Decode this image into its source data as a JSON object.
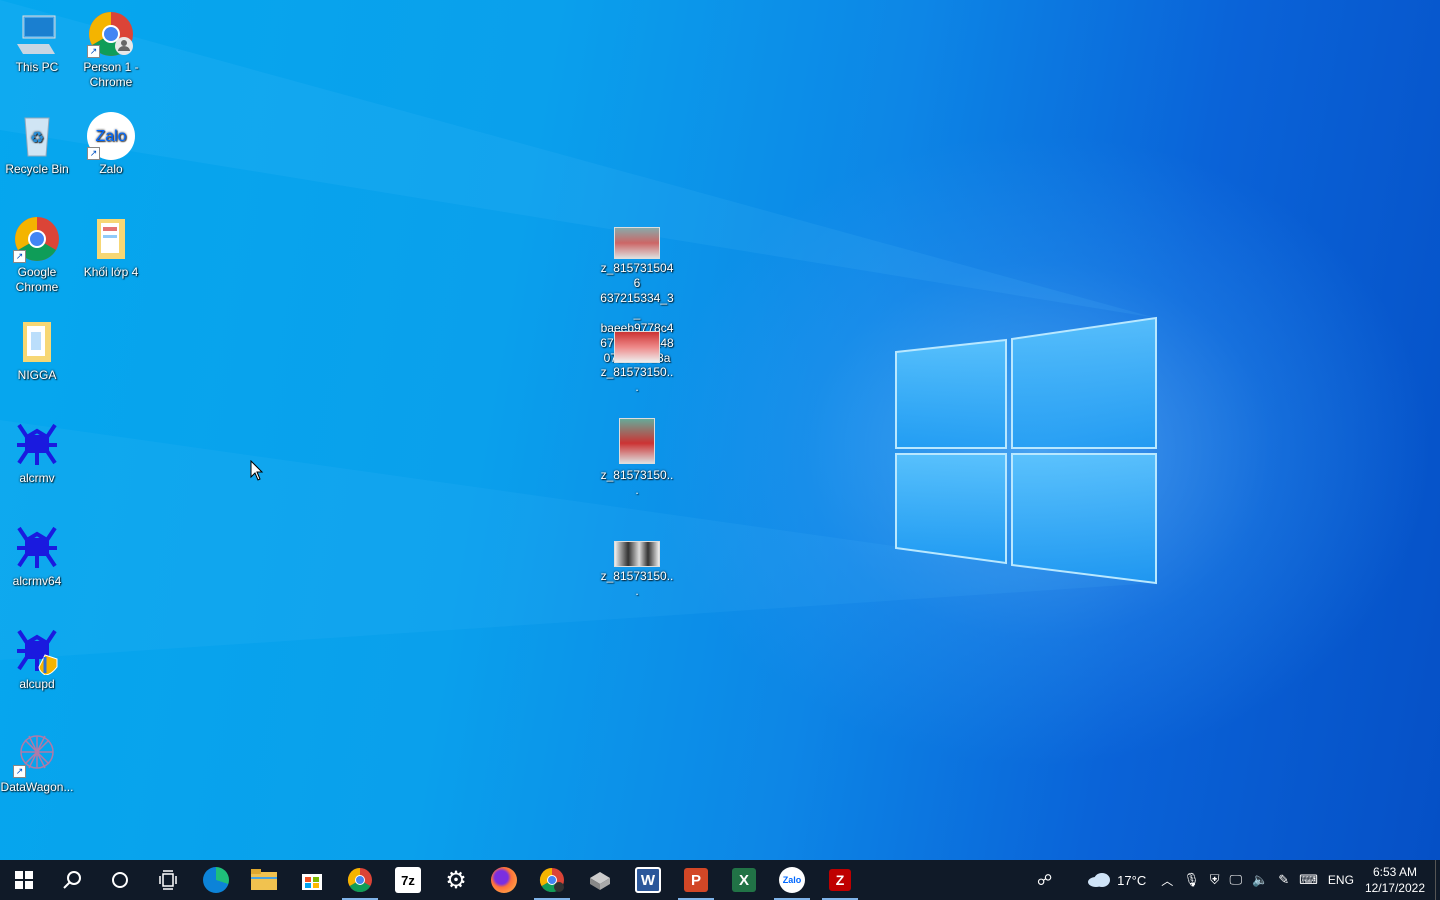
{
  "desktop": {
    "icons": [
      {
        "label": "This PC",
        "icon": "this-pc-icon"
      },
      {
        "label": "Person 1 - Chrome",
        "icon": "chrome-profile-icon"
      },
      {
        "label": "Recycle Bin",
        "icon": "recycle-bin-icon"
      },
      {
        "label": "Zalo",
        "icon": "zalo-icon"
      },
      {
        "label": "Google Chrome",
        "icon": "chrome-icon"
      },
      {
        "label": "Khối lớp 4",
        "icon": "folder-icon"
      },
      {
        "label": "NIGGA",
        "icon": "folder-icon"
      },
      {
        "label": "alcrmv",
        "icon": "realtek-icon"
      },
      {
        "label": "alcrmv64",
        "icon": "realtek-icon"
      },
      {
        "label": "alcupd",
        "icon": "realtek-shield-icon"
      },
      {
        "label": "DataWagon...",
        "icon": "datawagon-icon"
      }
    ],
    "files": [
      {
        "label": "z_8157315046\n637215334_3_\nbaeeb9778c4\n67d46578a48\n072e4d728a"
      },
      {
        "label": "z_81573150..."
      },
      {
        "label": "z_81573150..."
      },
      {
        "label": "z_81573150..."
      }
    ]
  },
  "taskbar": {
    "apps": [
      {
        "name": "start-button",
        "icon": "windows-icon"
      },
      {
        "name": "search-button",
        "icon": "search-icon"
      },
      {
        "name": "cortana-button",
        "icon": "cortana-icon"
      },
      {
        "name": "task-view-button",
        "icon": "task-view-icon"
      },
      {
        "name": "edge-button",
        "icon": "edge-icon"
      },
      {
        "name": "file-explorer-button",
        "icon": "folder-icon"
      },
      {
        "name": "store-button",
        "icon": "store-icon"
      },
      {
        "name": "chrome-button",
        "icon": "chrome-icon",
        "active": true
      },
      {
        "name": "7zip-button",
        "icon": "7zip-icon",
        "text": "7z"
      },
      {
        "name": "settings-button",
        "icon": "gear-icon"
      },
      {
        "name": "firefox-button",
        "icon": "firefox-icon"
      },
      {
        "name": "chrome-profile-button",
        "icon": "chrome-profile-icon",
        "active": true
      },
      {
        "name": "winrar-button",
        "icon": "winrar-icon"
      },
      {
        "name": "word-button",
        "icon": "word-icon",
        "text": "W"
      },
      {
        "name": "powerpoint-button",
        "icon": "powerpoint-icon",
        "text": "P",
        "active": true
      },
      {
        "name": "excel-button",
        "icon": "excel-icon",
        "text": "X"
      },
      {
        "name": "zalo-button",
        "icon": "zalo-icon",
        "text": "Zalo",
        "active": true
      },
      {
        "name": "filezilla-button",
        "icon": "filezilla-icon",
        "active": true
      }
    ],
    "tray": {
      "weather": "17°C",
      "language": "ENG",
      "time": "6:53 AM",
      "date": "12/17/2022"
    }
  },
  "colors": {
    "taskbar_bg": "#101a28",
    "accent": "#0a84e8"
  }
}
